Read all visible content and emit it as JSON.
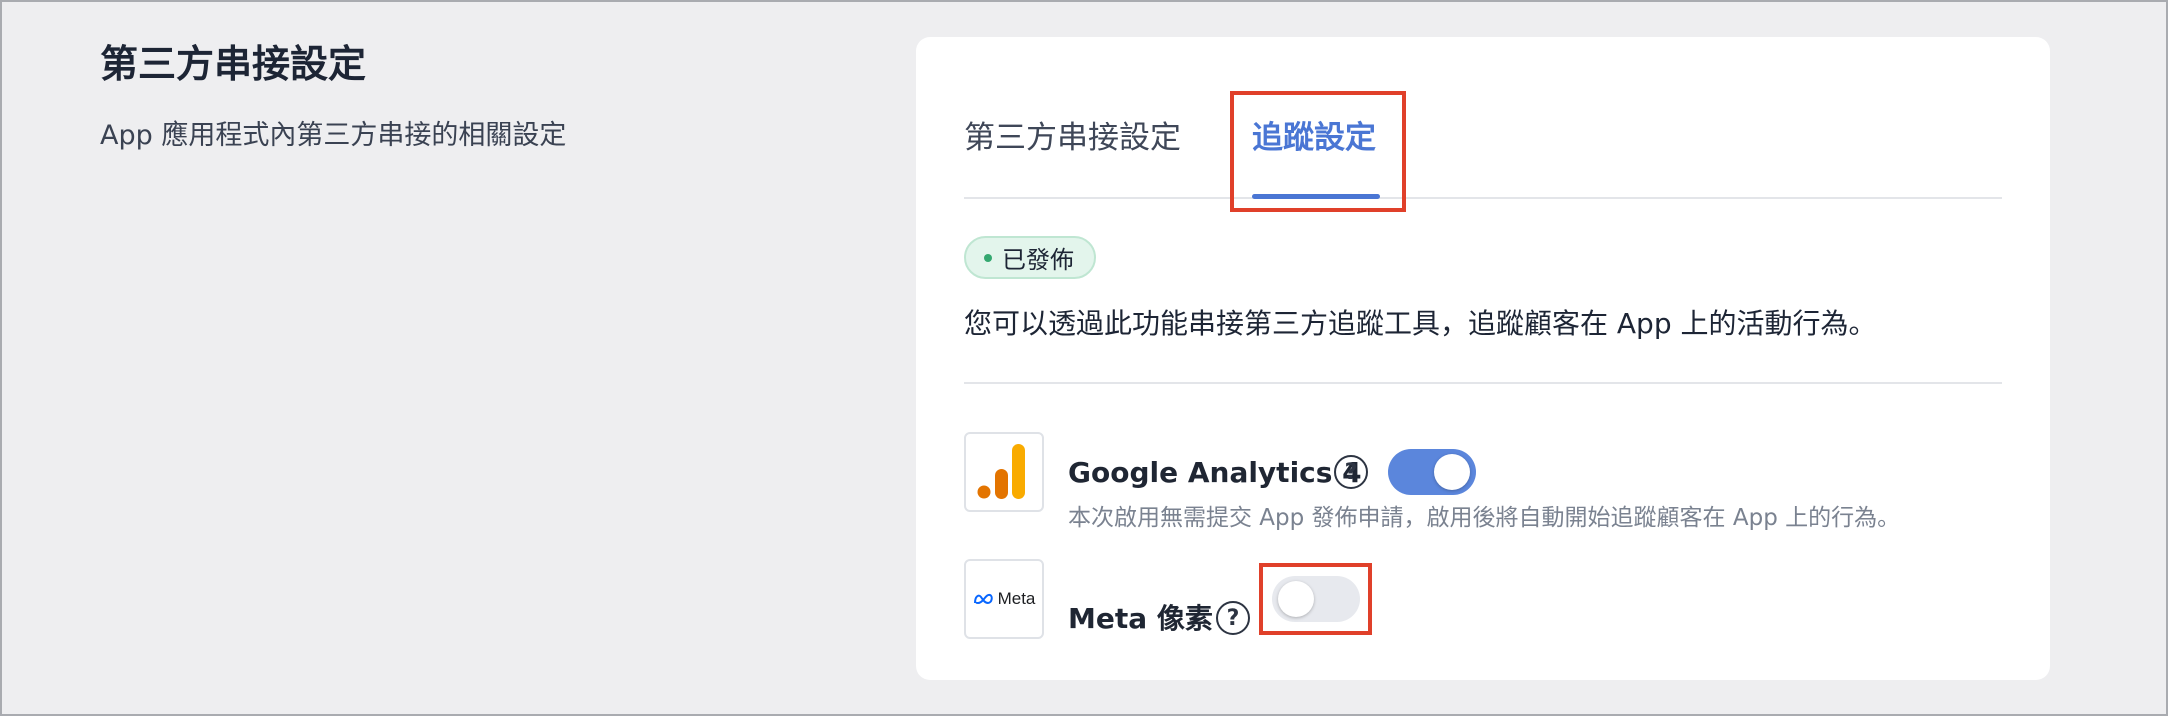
{
  "header": {
    "title": "第三方串接設定",
    "description": "App 應用程式內第三方串接的相關設定"
  },
  "tabs": [
    {
      "label": "第三方串接設定",
      "active": false
    },
    {
      "label": "追蹤設定",
      "active": true
    }
  ],
  "status": {
    "label": "已發佈",
    "color": "#34a870"
  },
  "intro_text": "您可以透過此功能串接第三方追蹤工具，追蹤顧客在 App 上的活動行為。",
  "integrations": [
    {
      "name": "Google Analytics 4",
      "enabled": true,
      "description": "本次啟用無需提交 App 發佈申請，啟用後將自動開始追蹤顧客在 App 上的行為。",
      "icon": "google-analytics-logo"
    },
    {
      "name": "Meta 像素",
      "enabled": false,
      "logo_text": "Meta",
      "icon": "meta-logo"
    }
  ],
  "help_symbol": "?",
  "colors": {
    "accent": "#4a76d4",
    "toggle_on": "#5b86dc",
    "highlight": "#e0402a"
  }
}
